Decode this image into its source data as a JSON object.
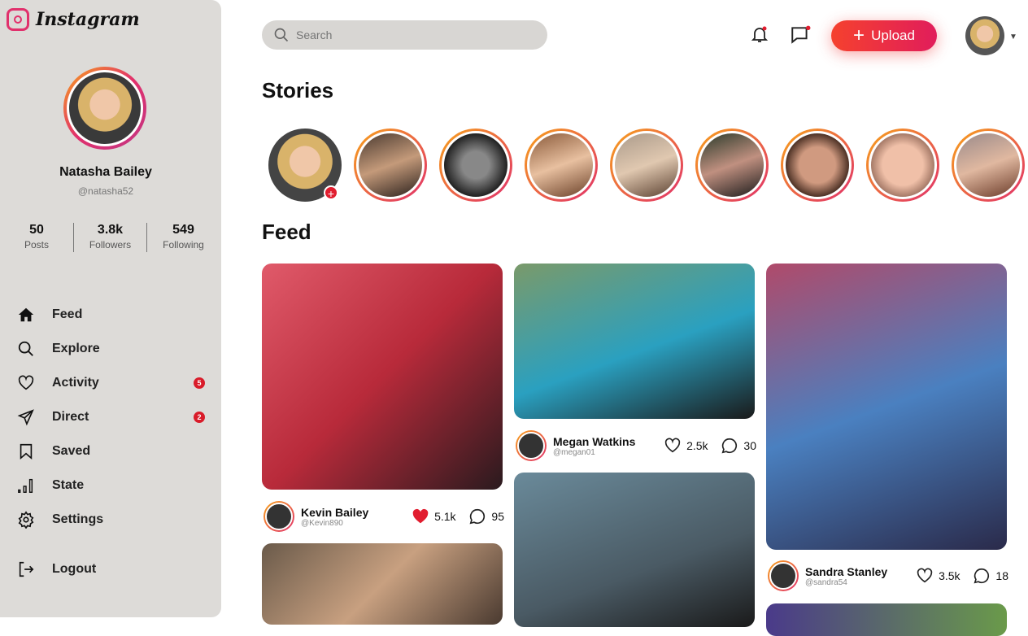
{
  "app": {
    "title": "Instagram"
  },
  "profile": {
    "name": "Natasha Bailey",
    "handle": "@natasha52",
    "stats": [
      {
        "value": "50",
        "label": "Posts"
      },
      {
        "value": "3.8k",
        "label": "Followers"
      },
      {
        "value": "549",
        "label": "Following"
      }
    ]
  },
  "nav": [
    {
      "label": "Feed",
      "icon": "home-icon"
    },
    {
      "label": "Explore",
      "icon": "search-icon"
    },
    {
      "label": "Activity",
      "icon": "heart-icon",
      "badge": "5"
    },
    {
      "label": "Direct",
      "icon": "send-icon",
      "badge": "2"
    },
    {
      "label": "Saved",
      "icon": "bookmark-icon"
    },
    {
      "label": "State",
      "icon": "bar-chart-icon"
    },
    {
      "label": "Settings",
      "icon": "gear-icon"
    }
  ],
  "logout": "Logout",
  "header": {
    "search_placeholder": "Search",
    "upload_label": "Upload"
  },
  "sections": {
    "stories": "Stories",
    "feed": "Feed"
  },
  "posts": [
    {
      "name": "Kevin Bailey",
      "handle": "@Kevin890",
      "likes": "5.1k",
      "comments": "95",
      "liked": true
    },
    {
      "name": "Megan Watkins",
      "handle": "@megan01",
      "likes": "2.5k",
      "comments": "30",
      "liked": false
    },
    {
      "name": "Sandra Stanley",
      "handle": "@sandra54",
      "likes": "3.5k",
      "comments": "18",
      "liked": false
    }
  ],
  "colors": {
    "accent": "#e1306c",
    "upload": "#f5412e",
    "badge": "#d91c2a"
  }
}
